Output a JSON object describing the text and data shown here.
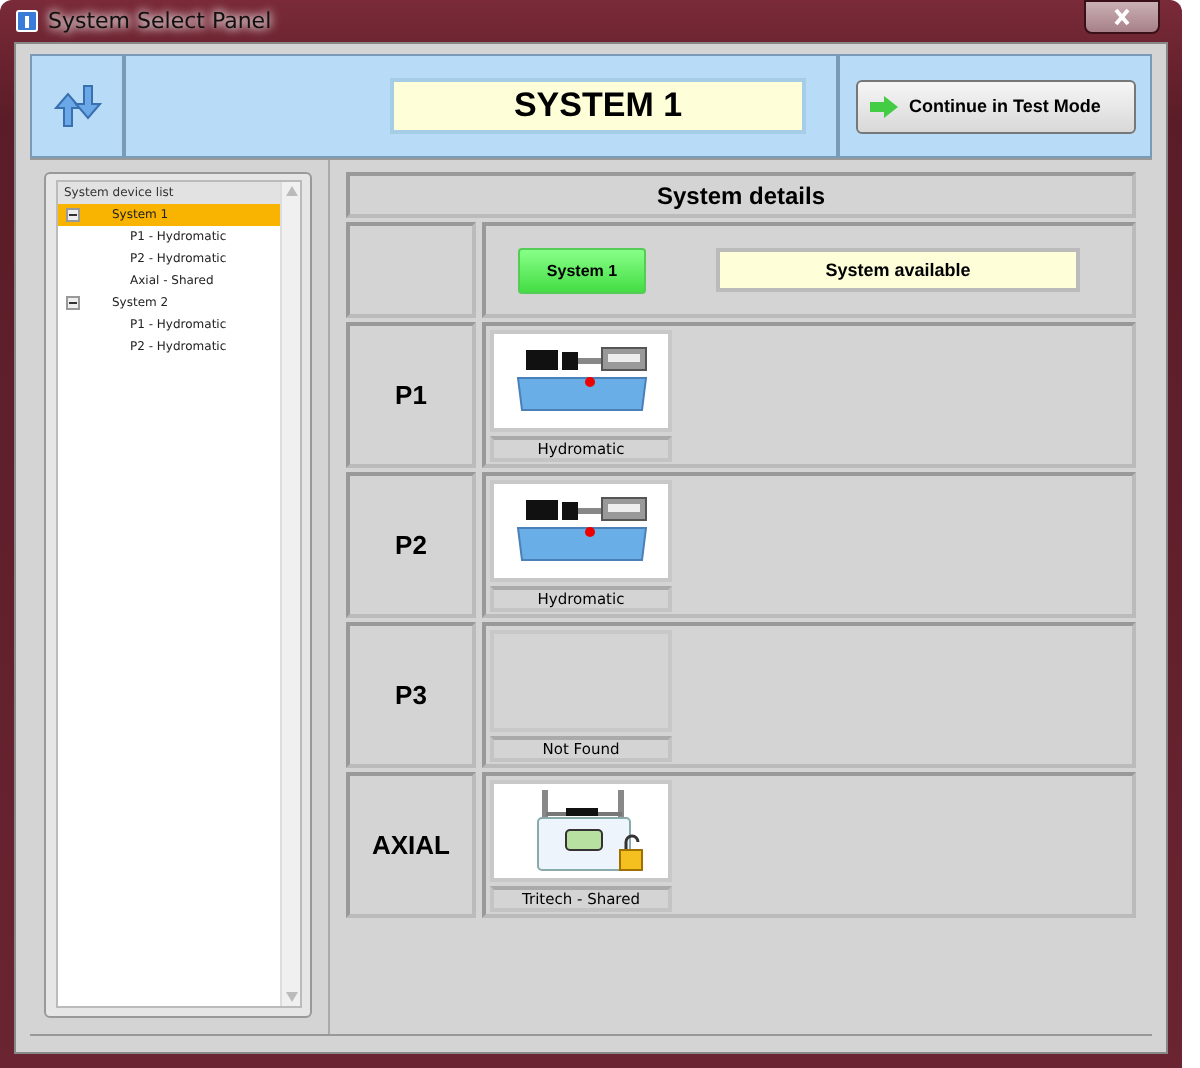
{
  "window": {
    "title": "System Select Panel"
  },
  "header": {
    "system_name": "SYSTEM 1",
    "continue_button": "Continue in Test Mode"
  },
  "tree": {
    "title": "System device list",
    "items": [
      {
        "label": "System 1",
        "selected": true,
        "expanded": true,
        "children": [
          {
            "label": "P1 - Hydromatic",
            "selected": false
          },
          {
            "label": "P2 - Hydromatic",
            "selected": false
          },
          {
            "label": "Axial - Shared",
            "selected": false
          }
        ]
      },
      {
        "label": "System 2",
        "selected": false,
        "expanded": true,
        "children": [
          {
            "label": "P1 - Hydromatic",
            "selected": false
          },
          {
            "label": "P2 - Hydromatic",
            "selected": false
          }
        ]
      }
    ]
  },
  "details": {
    "title": "System details",
    "system_button": "System 1",
    "status": "System available",
    "rows": [
      {
        "label": "P1",
        "kind": "hydromatic",
        "caption": "Hydromatic"
      },
      {
        "label": "P2",
        "kind": "hydromatic",
        "caption": "Hydromatic"
      },
      {
        "label": "P3",
        "kind": "empty",
        "caption": "Not Found"
      },
      {
        "label": "AXIAL",
        "kind": "tritech",
        "caption": "Tritech - Shared"
      }
    ]
  }
}
